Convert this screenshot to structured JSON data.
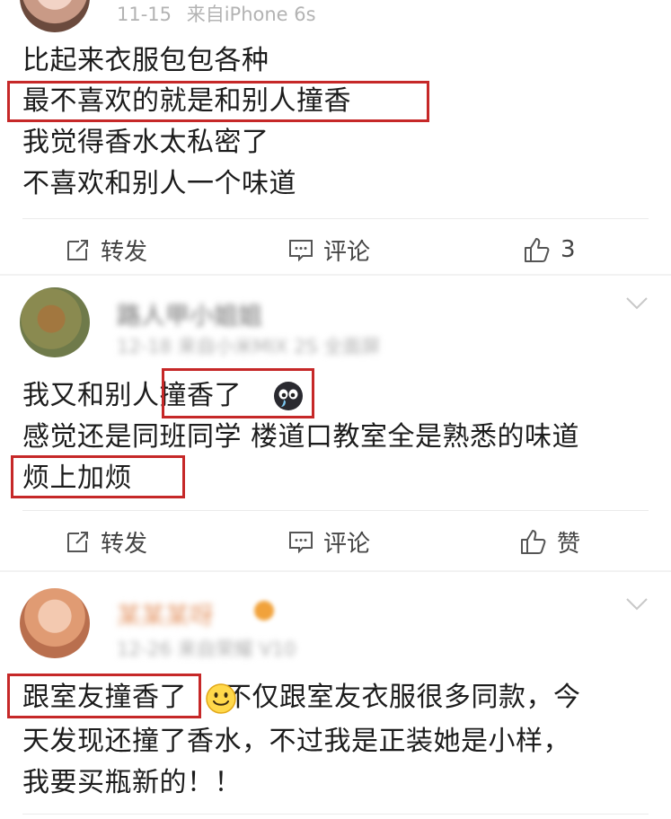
{
  "posts": [
    {
      "time": "11-15",
      "source": "来自iPhone 6s",
      "lines": [
        "比起来衣服包包各种",
        "最不喜欢的就是和别人撞香",
        "我觉得香水太私密了",
        "不喜欢和别人一个味道"
      ],
      "actions": {
        "repost": "转发",
        "comment": "评论",
        "like": "3"
      }
    },
    {
      "username_blurred": "路人甲小姐姐",
      "meta_blurred": "12-18 来自小米MIX 2S 全面屏",
      "lines_part1": "我又和别人",
      "lines_part2": "撞香了",
      "line2": "感觉还是同班同学 楼道口教室全是熟悉的味道",
      "line3": "烦上加烦",
      "actions": {
        "repost": "转发",
        "comment": "评论",
        "like": "赞"
      }
    },
    {
      "username_blurred": "某某某呀",
      "meta_blurred": "12-26 来自荣耀 V10",
      "line1_part1": "跟室友撞香了",
      "line1_part2": "不仅跟室友衣服很多同款，今",
      "line2": "天发现还撞了香水，不过我是正装她是小样，",
      "line3": "我要买瓶新的！！"
    }
  ],
  "colors": {
    "highlight": "#c62828",
    "text": "#1c1c1c",
    "meta": "#b3b3b3"
  }
}
